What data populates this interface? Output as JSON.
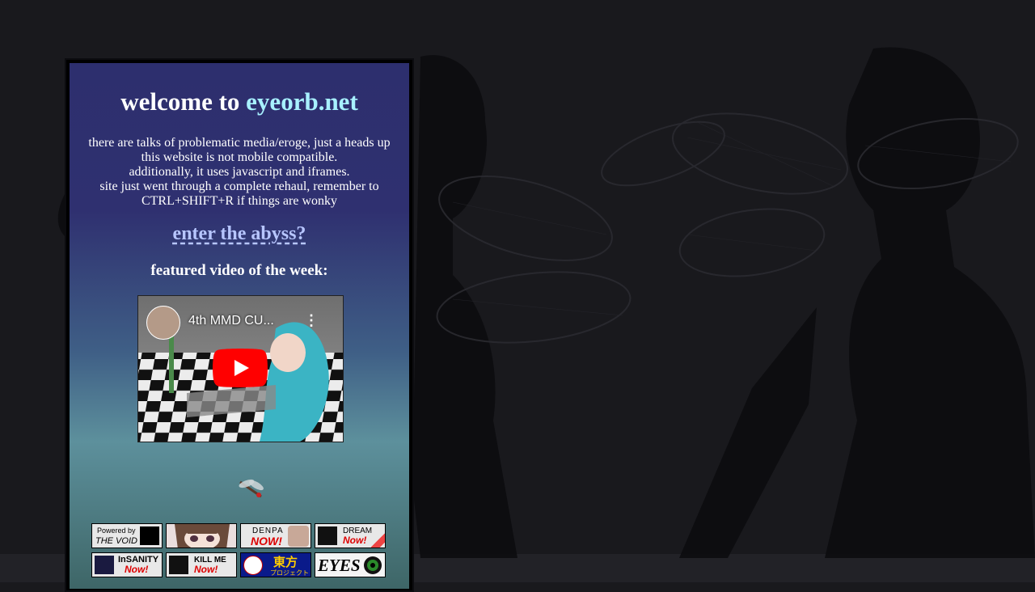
{
  "welcome": {
    "prefix": "welcome to ",
    "site": "eyeorb.net"
  },
  "notice": {
    "lines": [
      "there are talks of problematic media/eroge, just a heads up",
      "this website is not mobile compatible.",
      "additionally, it uses javascript and iframes.",
      "site just went through a complete rehaul, remember to",
      "CTRL+SHIFT+R if things are wonky"
    ]
  },
  "enter_link": "enter the abyss?",
  "featured_heading": "featured video of the week:",
  "video": {
    "title": "4th MMD CU...",
    "menu": "⋮"
  },
  "badges": {
    "void": {
      "top": "Powered by",
      "bottom": "THE VOID"
    },
    "denpa": {
      "top": "DENPA",
      "bottom": "NOW!"
    },
    "dream": {
      "top": "DREAM",
      "bottom": "Now!"
    },
    "insanity": {
      "top": "InSANITY",
      "bottom": "Now!"
    },
    "killme": {
      "top": "KILL ME",
      "bottom": "Now!"
    },
    "touhou": {
      "top": "東方",
      "bottom": "プロジェクト"
    },
    "eyes": {
      "top": "EYES"
    }
  }
}
